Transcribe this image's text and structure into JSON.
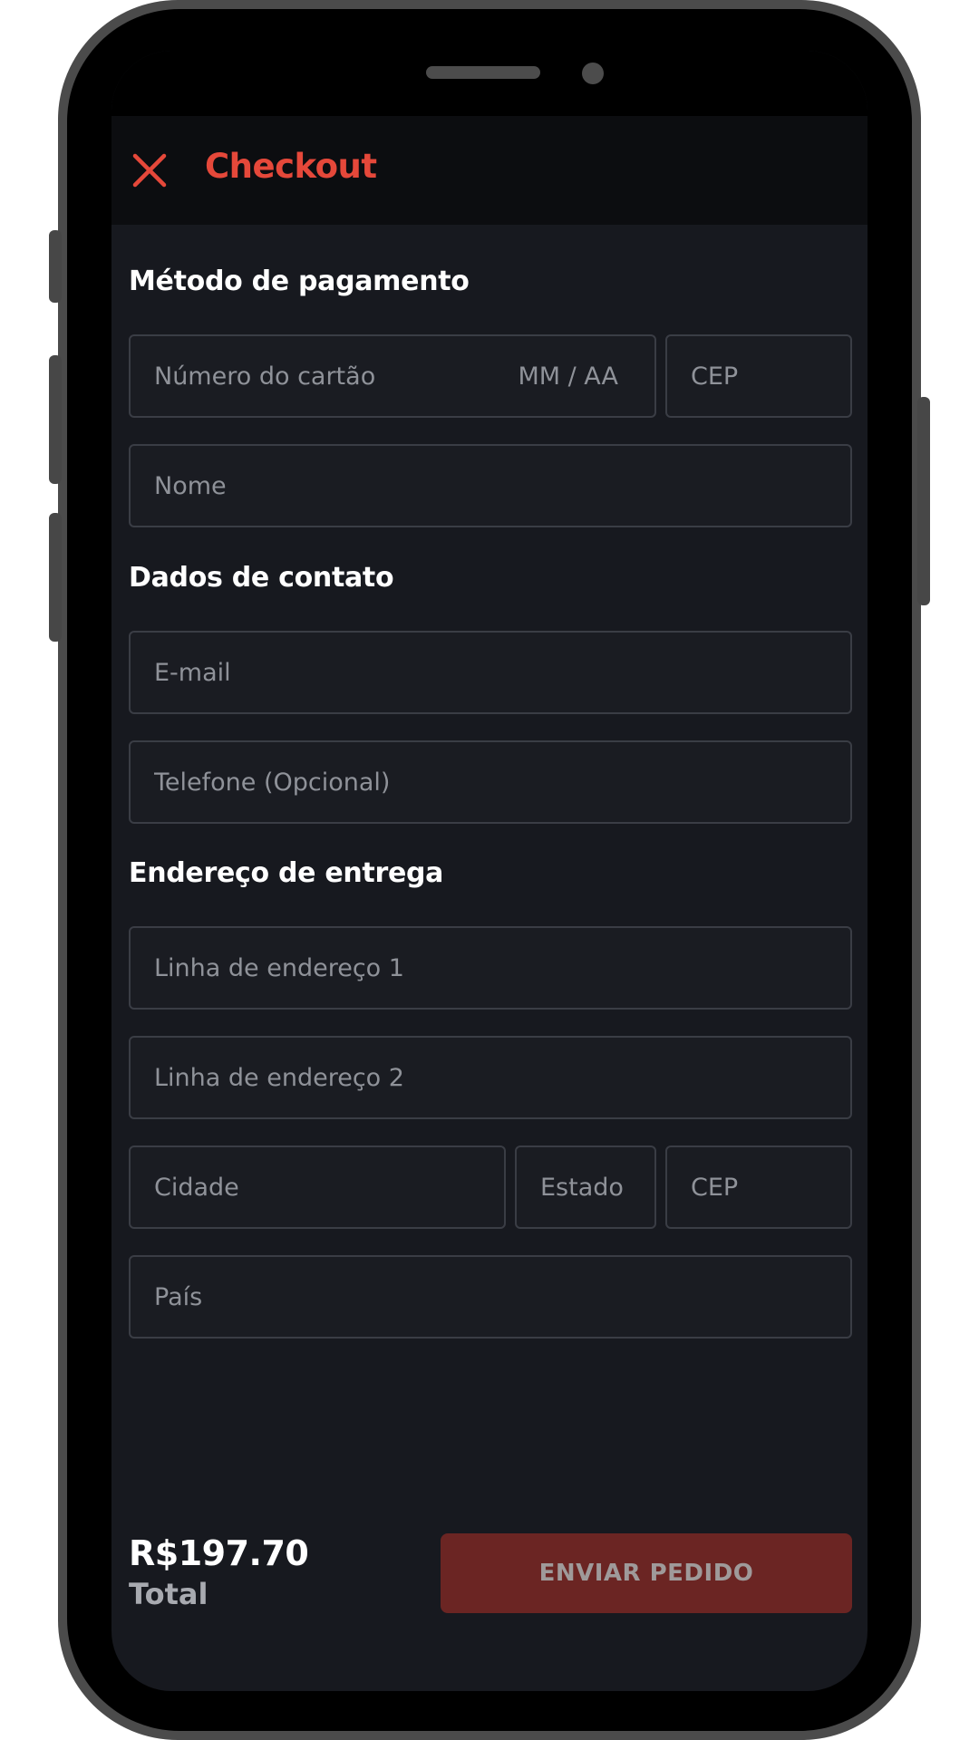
{
  "app_bar": {
    "title": "Checkout",
    "close_icon": "close-icon",
    "accent_color": "#e5483a"
  },
  "payment": {
    "section_title": "Método de pagamento",
    "card_number_placeholder": "Número do cartão",
    "expiry_placeholder": "MM / AA",
    "zip_placeholder": "CEP",
    "name_placeholder": "Nome"
  },
  "contact": {
    "section_title": "Dados de contato",
    "email_placeholder": "E-mail",
    "phone_placeholder": "Telefone (Opcional)"
  },
  "shipping": {
    "section_title": "Endereço de entrega",
    "address1_placeholder": "Linha de endereço 1",
    "address2_placeholder": "Linha de endereço 2",
    "city_placeholder": "Cidade",
    "state_placeholder": "Estado",
    "zip_placeholder": "CEP",
    "country_placeholder": "País"
  },
  "footer": {
    "total_amount": "R$197.70",
    "total_label": "Total",
    "submit_label": "ENVIAR PEDIDO",
    "submit_color": "#6b2523"
  }
}
